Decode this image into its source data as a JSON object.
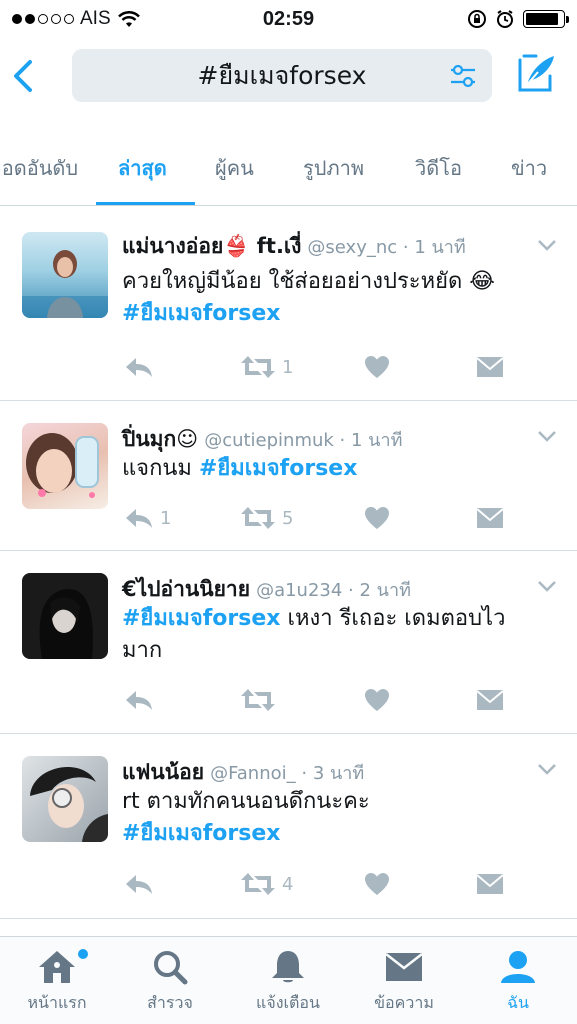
{
  "status_bar": {
    "carrier": "AIS",
    "time": "02:59",
    "battery_level": 0.9
  },
  "search": {
    "query": "#ยืมเมจforsex"
  },
  "tabs": [
    {
      "label": "ยอดอันดับ",
      "active": false
    },
    {
      "label": "ล่าสุด",
      "active": true
    },
    {
      "label": "ผู้คน",
      "active": false
    },
    {
      "label": "รูปภาพ",
      "active": false
    },
    {
      "label": "วิดีโอ",
      "active": false
    },
    {
      "label": "ข่าว",
      "active": false
    }
  ],
  "tweets": [
    {
      "name": "แม่นางอ่อย👙 ft.เงี่",
      "handle": "@sexy_nc",
      "time": "1 นาที",
      "text": "ควยใหญ่มีน้อย ใช้ส่อยอย่างประหยัด 😂",
      "hashtag": "#ยืมเมจforsex",
      "reply_count": "",
      "retweet_count": "1"
    },
    {
      "name": "ปิ่นมุก☺",
      "handle": "@cutiepinmuk",
      "time": "1 นาที",
      "text_prefix": "แจกนม ",
      "hashtag": "#ยืมเมจforsex",
      "reply_count": "1",
      "retweet_count": "5"
    },
    {
      "name": "€ไปอ่านนิยาย",
      "handle": "@a1u234",
      "time": "2 นาที",
      "hashtag": "#ยืมเมจforsex",
      "text_suffix": " เหงา รีเถอะ เดมตอบไว",
      "text_line2": "มาก",
      "reply_count": "",
      "retweet_count": ""
    },
    {
      "name": "แฟนน้อย",
      "handle": "@Fannoi_",
      "time": "3 นาที",
      "text": "rt ตามทักคนนอนดึกนะคะ",
      "hashtag": "#ยืมเมจforsex",
      "reply_count": "",
      "retweet_count": "4"
    }
  ],
  "bottom_nav": [
    {
      "label": "หน้าแรก",
      "icon": "home-icon",
      "has_dot": true
    },
    {
      "label": "สำรวจ",
      "icon": "search-icon"
    },
    {
      "label": "แจ้งเตือน",
      "icon": "bell-icon"
    },
    {
      "label": "ข้อความ",
      "icon": "envelope-icon"
    },
    {
      "label": "ฉัน",
      "icon": "person-icon",
      "active": true
    }
  ],
  "colors": {
    "accent": "#1da1f2",
    "muted": "#aab8c2",
    "text": "#14171a"
  }
}
